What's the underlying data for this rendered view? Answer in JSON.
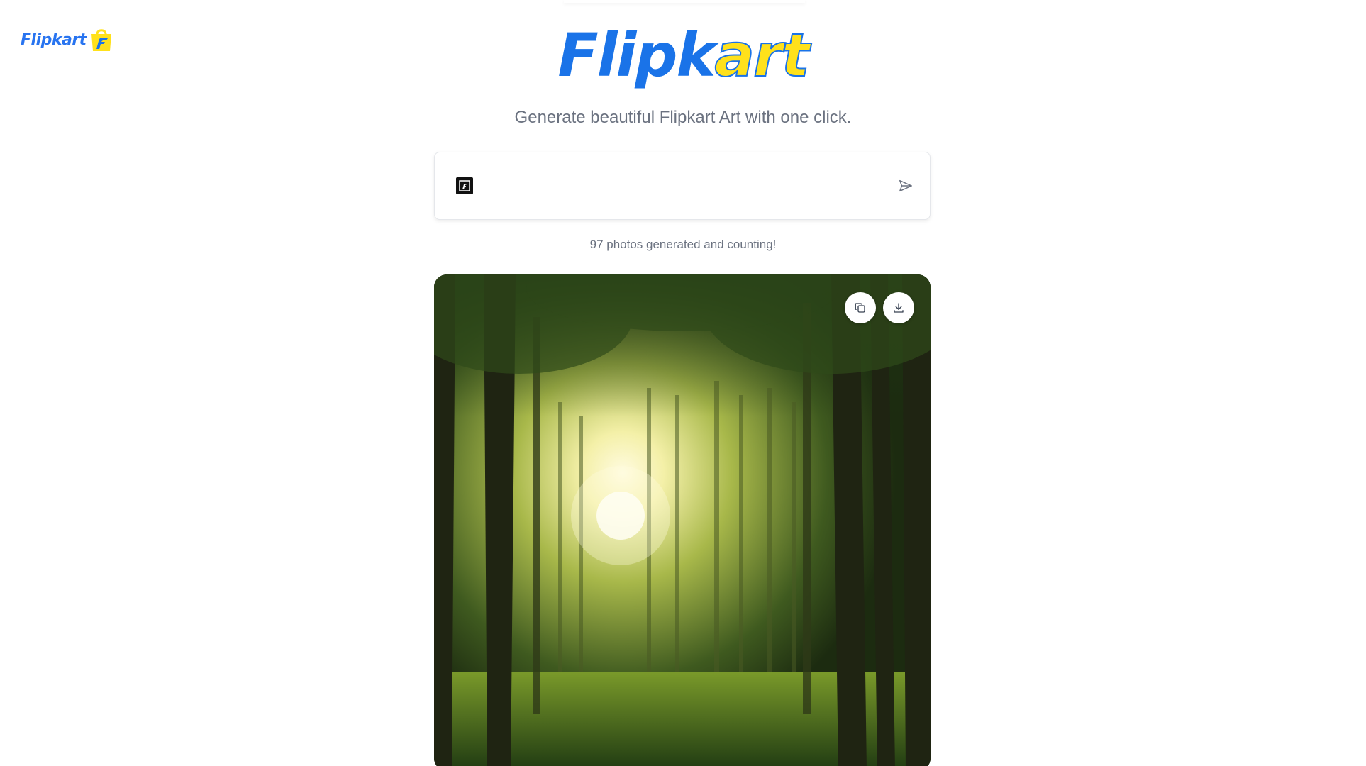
{
  "header": {
    "corner_logo_text": "Flipkart",
    "hero_logo_part1": "Flipk",
    "hero_logo_part2": "art",
    "tagline": "Generate beautiful Flipkart Art with one click."
  },
  "prompt": {
    "value": "",
    "placeholder": "",
    "send_icon": "send-icon",
    "prefix_icon": "flipkart-bag-icon"
  },
  "counter_text": "97 photos generated and counting!",
  "image_card": {
    "description_icon": "sunlit-forest-image",
    "actions": [
      {
        "icon": "copy-icon"
      },
      {
        "icon": "download-icon"
      }
    ]
  },
  "colors": {
    "brand_blue": "#1a73e8",
    "brand_yellow": "#ffe11b",
    "muted_text": "#6b7280"
  }
}
